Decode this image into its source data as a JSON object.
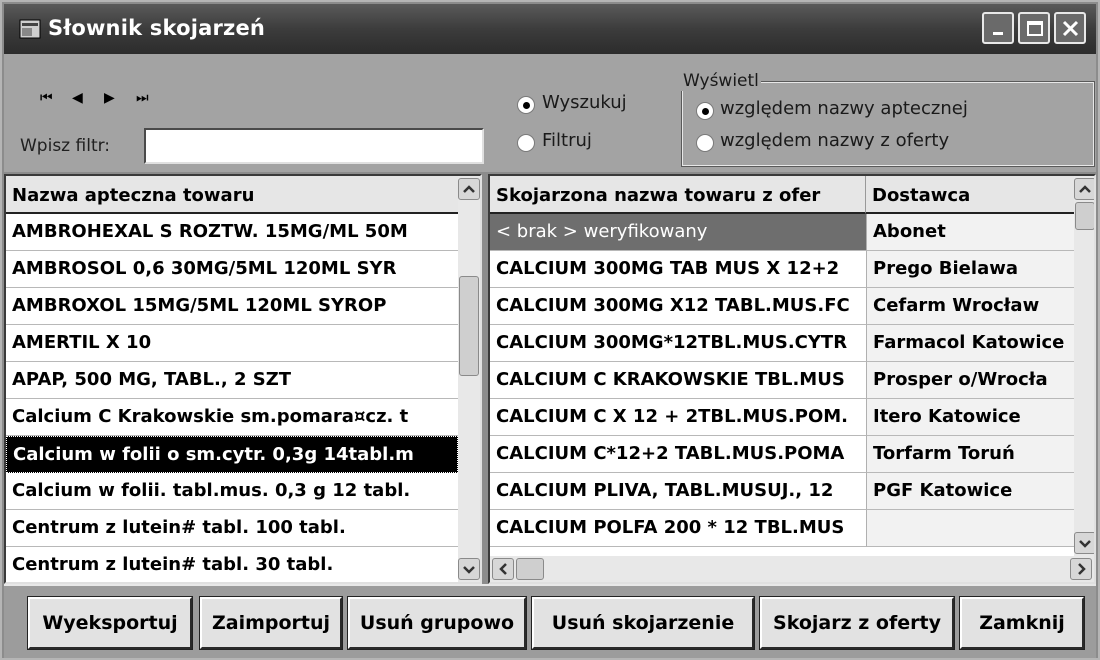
{
  "window": {
    "title": "Słownik skojarzeń"
  },
  "nav": {
    "first": "⏮",
    "prev": "◀",
    "next": "▶",
    "last": "⏭"
  },
  "filter": {
    "label": "Wpisz filtr:",
    "value": ""
  },
  "mode": {
    "search_label": "Wyszukuj",
    "filter_label": "Filtruj",
    "selected": "Wyszukuj"
  },
  "display": {
    "title": "Wyświetl",
    "by_pharmacy_label": "względem nazwy aptecznej",
    "by_offer_label": "względem nazwy z oferty",
    "selected": "względem nazwy aptecznej"
  },
  "left_grid": {
    "header": "Nazwa apteczna towaru",
    "rows": [
      "AMBROHEXAL S ROZTW. 15MG/ML 50M",
      "AMBROSOL 0,6  30MG/5ML 120ML SYR",
      "AMBROXOL 15MG/5ML 120ML SYROP",
      "AMERTIL X 10",
      "APAP, 500 MG, TABL., 2 SZT",
      "Calcium C Krakowskie sm.pomara¤cz. t",
      "Calcium w folii o sm.cytr. 0,3g 14tabl.m",
      "Calcium w folii. tabl.mus. 0,3 g 12 tabl.",
      "Centrum z lutein# tabl. 100 tabl.",
      "Centrum z lutein# tabl. 30 tabl."
    ],
    "selected_index": 6
  },
  "right_grid": {
    "col1_header": "Skojarzona nazwa towaru z ofer",
    "col2_header": "Dostawca",
    "rows": [
      {
        "name": "< brak > weryfikowany",
        "supplier": "Abonet"
      },
      {
        "name": "CALCIUM 300MG TAB MUS X 12+2",
        "supplier": "Prego Bielawa"
      },
      {
        "name": "CALCIUM 300MG X12 TABL.MUS.FC",
        "supplier": "Cefarm Wrocław"
      },
      {
        "name": "CALCIUM 300MG*12TBL.MUS.CYTR",
        "supplier": "Farmacol Katowice"
      },
      {
        "name": "CALCIUM C KRAKOWSKIE TBL.MUS",
        "supplier": "Prosper o/Wrocła"
      },
      {
        "name": "CALCIUM C X 12 + 2TBL.MUS.POM.",
        "supplier": "Itero Katowice"
      },
      {
        "name": "CALCIUM C*12+2 TABL.MUS.POMA",
        "supplier": "Torfarm Toruń"
      },
      {
        "name": "CALCIUM PLIVA, TABL.MUSUJ., 12",
        "supplier": "PGF Katowice"
      },
      {
        "name": "CALCIUM POLFA 200 * 12 TBL.MUS",
        "supplier": ""
      }
    ],
    "highlighted_index": 0
  },
  "buttons": {
    "export": "Wyeksportuj",
    "import": "Zaimportuj",
    "delete_group": "Usuń grupowo",
    "delete_link": "Usuń skojarzenie",
    "link_offer": "Skojarz z oferty",
    "close": "Zamknij"
  }
}
